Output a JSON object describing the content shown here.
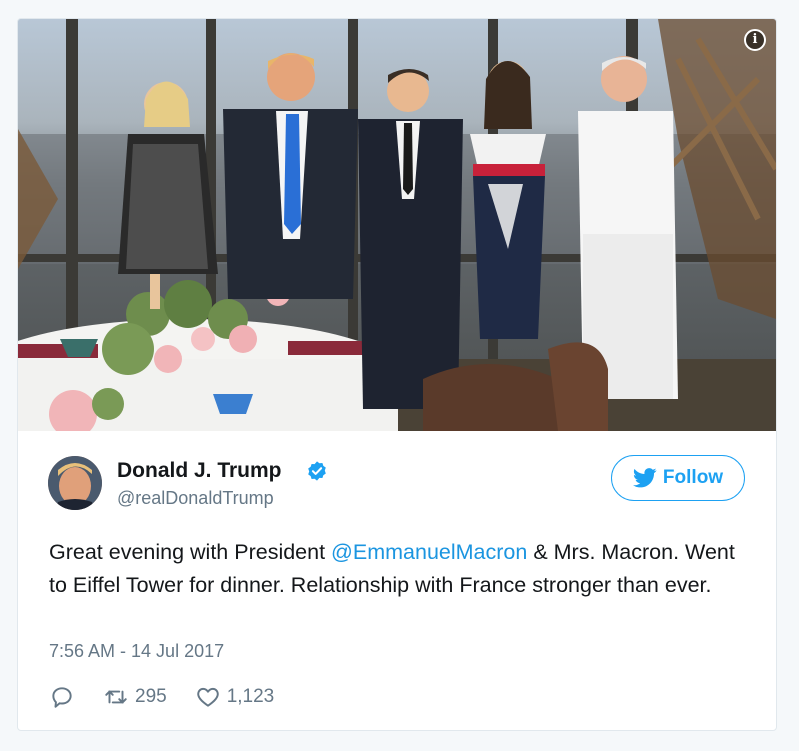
{
  "tweet": {
    "author_name": "Donald J. Trump",
    "handle": "@realDonaldTrump",
    "follow_label": "Follow",
    "text_parts": [
      "Great evening with President ",
      "@EmmanuelMacron",
      " & Mrs. Macron. Went to Eiffel Tower for dinner. Relationship with France stronger than ever."
    ],
    "timestamp": "7:56 AM - 14 Jul 2017",
    "retweet_count": "295",
    "like_count": "1,123"
  },
  "icons": {
    "info": "info-icon",
    "verified": "verified-badge-icon",
    "follow_bird": "twitter-bird-icon",
    "reply": "reply-icon",
    "retweet": "retweet-icon",
    "like": "heart-icon"
  },
  "colors": {
    "accent": "#1da1f2",
    "mention": "#1b95e0",
    "text": "#14171a",
    "muted": "#657786"
  }
}
